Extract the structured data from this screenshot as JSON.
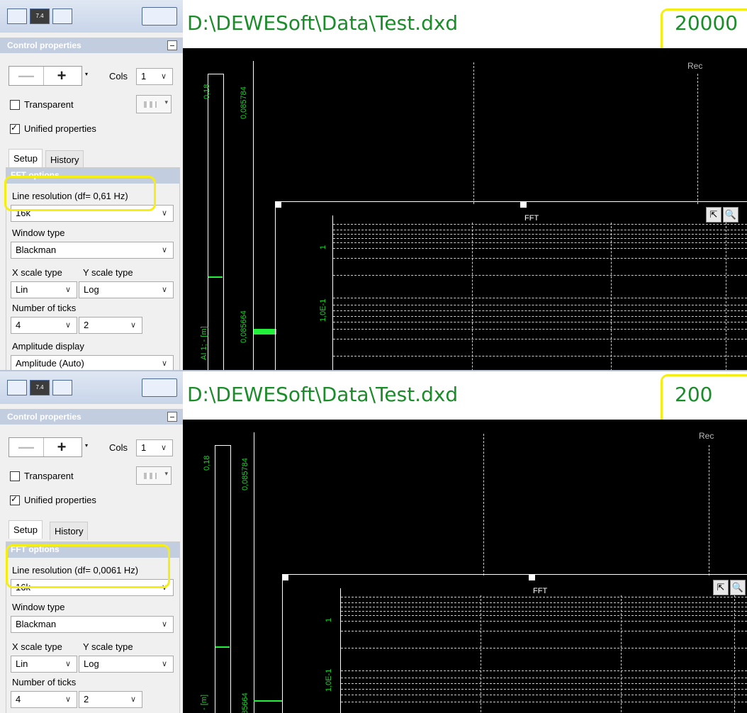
{
  "panels": [
    {
      "id": "top",
      "path": "D:\\DEWESoft\\Data\\Test.dxd",
      "value_box": "20000",
      "control_properties": "Control properties",
      "cols_label": "Cols",
      "cols_value": "1",
      "transparent_label": "Transparent",
      "unified_label": "Unified properties",
      "tabs": [
        "Setup",
        "History"
      ],
      "fft_options": "FFT options",
      "line_resolution": "Line resolution (df= 0,61 Hz)",
      "line_resolution_value": "16k",
      "window_type_label": "Window type",
      "window_type_value": "Blackman",
      "x_scale_label": "X scale type",
      "y_scale_label": "Y scale type",
      "x_scale_value": "Lin",
      "y_scale_value": "Log",
      "ticks_label": "Number of ticks",
      "ticks_x": "4",
      "ticks_y": "2",
      "amplitude_label": "Amplitude display",
      "amplitude_value": "Amplitude (Auto)",
      "axis_top": "0,18",
      "axis_val_top": "0,085784",
      "axis_val_bottom": "0,085664",
      "channel_label": "AI 1; - [m]",
      "rec_label": "Rec",
      "fft_title": "FFT",
      "fft_tick_1": "1",
      "fft_tick_2": "1,0E-1"
    },
    {
      "id": "bottom",
      "path": "D:\\DEWESoft\\Data\\Test.dxd",
      "value_box": "200",
      "control_properties": "Control properties",
      "cols_label": "Cols",
      "cols_value": "1",
      "transparent_label": "Transparent",
      "unified_label": "Unified properties",
      "tabs": [
        "Setup",
        "History"
      ],
      "fft_options": "FFT options",
      "line_resolution": "Line resolution (df= 0,0061 Hz)",
      "line_resolution_value": "16k",
      "window_type_label": "Window type",
      "window_type_value": "Blackman",
      "x_scale_label": "X scale type",
      "y_scale_label": "Y scale type",
      "x_scale_value": "Lin",
      "y_scale_value": "Log",
      "ticks_label": "Number of ticks",
      "ticks_x": "4",
      "ticks_y": "2",
      "axis_top": "0,18",
      "axis_val_top": "0,085784",
      "axis_val_bottom": "85664",
      "channel_label": "; - [m]",
      "rec_label": "Rec",
      "fft_title": "FFT",
      "fft_tick_1": "1",
      "fft_tick_2": "1,0E-1"
    }
  ],
  "colors": {
    "accent_green": "#1b8c2a",
    "plot_green": "#22f03a",
    "highlight_yellow": "#f5ee14",
    "header_blue": "#c2cde0"
  }
}
